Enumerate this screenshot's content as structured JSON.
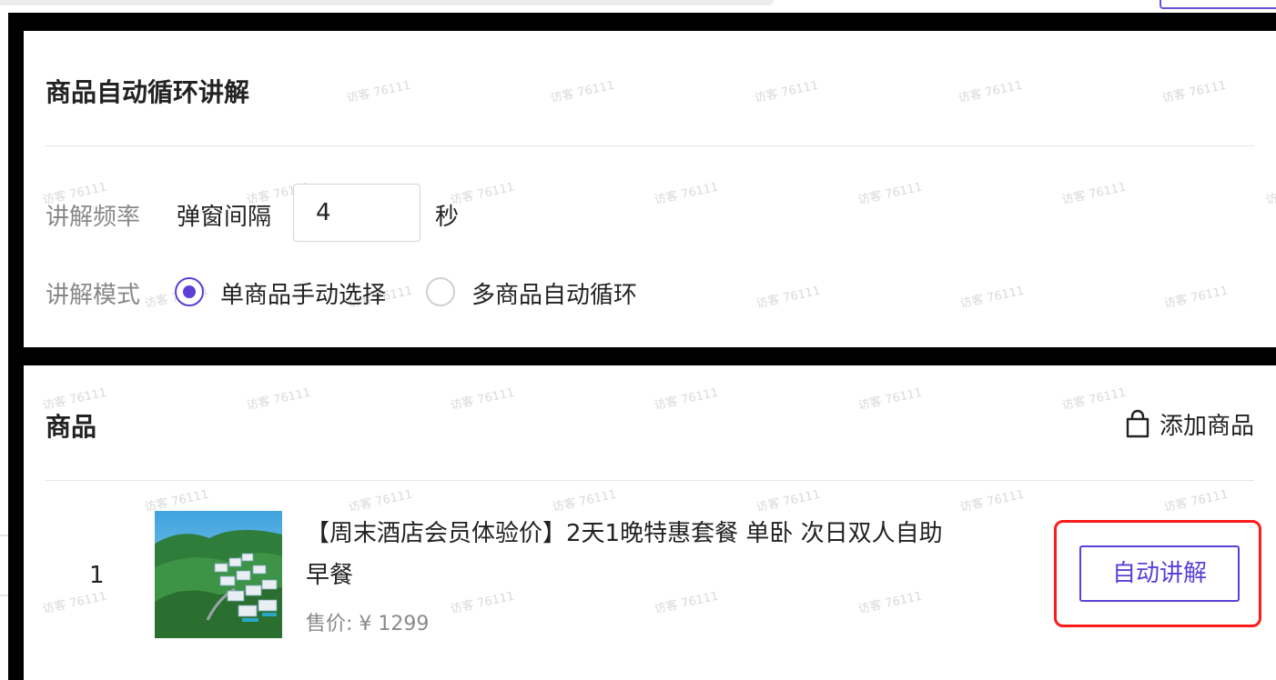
{
  "watermark_text": "访客 76111",
  "settings_panel": {
    "title": "商品自动循环讲解",
    "frequency_label": "讲解频率",
    "interval_label": "弹窗间隔",
    "interval_value": "4",
    "interval_unit": "秒",
    "mode_label": "讲解模式",
    "mode_options": [
      {
        "label": "单商品手动选择",
        "selected": true
      },
      {
        "label": "多商品自动循环",
        "selected": false
      }
    ]
  },
  "goods_panel": {
    "title": "商品",
    "add_button_label": "添加商品",
    "add_button_icon": "shopping-bag-icon",
    "items": [
      {
        "index": "1",
        "title": "【周末酒店会员体验价】2天1晚特惠套餐 单卧 次日双人自助早餐",
        "price": "售价: ¥ 1299",
        "action_label": "自动讲解",
        "thumbnail": "hotel-mountain-thumbnail"
      }
    ]
  },
  "colors": {
    "accent": "#5b3fd6",
    "highlight": "#ff1a1a",
    "muted_text": "#888888",
    "divider": "#e6e6e6"
  }
}
